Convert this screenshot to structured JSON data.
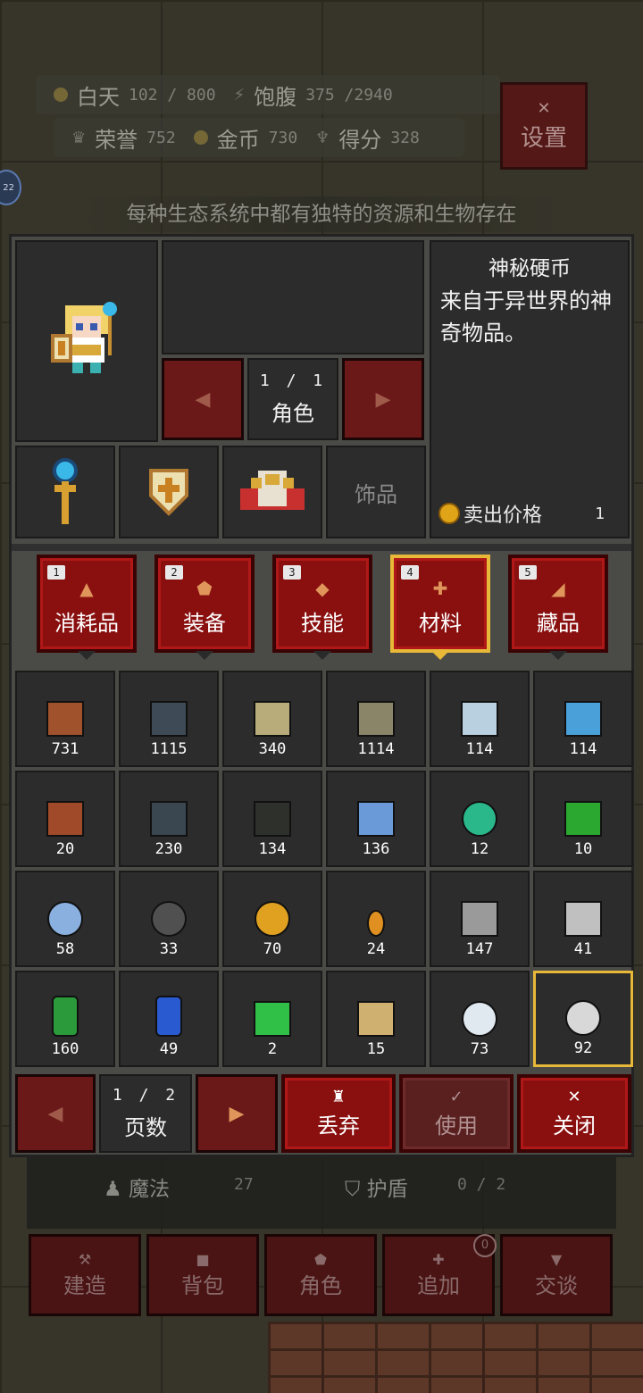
{
  "hud": {
    "day_label": "白天",
    "day_value": "102 / 800",
    "satiety_label": "饱腹",
    "satiety_value": "375 /2940",
    "honor_label": "荣誉",
    "honor_value": "752",
    "gold_label": "金币",
    "gold_value": "730",
    "score_label": "得分",
    "score_value": "328",
    "settings_label": "设置"
  },
  "tip": "每种生态系统中都有独特的资源和生物存在",
  "character": {
    "page": "1 / 1",
    "page_label": "角色",
    "accessory_label": "饰品"
  },
  "description": {
    "title": "神秘硬币",
    "text": "来自于异世界的神奇物品。",
    "sell_label": "卖出价格",
    "sell_value": "1"
  },
  "tabs": [
    {
      "num": "1",
      "label": "消耗品"
    },
    {
      "num": "2",
      "label": "装备"
    },
    {
      "num": "3",
      "label": "技能"
    },
    {
      "num": "4",
      "label": "材料",
      "active": true
    },
    {
      "num": "5",
      "label": "藏品"
    }
  ],
  "items": [
    {
      "count": "731",
      "icon": "dirt-block",
      "color": "#a0522d"
    },
    {
      "count": "1115",
      "icon": "stone-block",
      "color": "#3e4a55"
    },
    {
      "count": "340",
      "icon": "sand-block",
      "color": "#b8ad7a"
    },
    {
      "count": "1114",
      "icon": "sandstone-block",
      "color": "#8a8468"
    },
    {
      "count": "114",
      "icon": "ice-block",
      "color": "#b8d0e0"
    },
    {
      "count": "114",
      "icon": "crystal-block",
      "color": "#4aa0d8"
    },
    {
      "count": "20",
      "icon": "brick-block",
      "color": "#a04a2a"
    },
    {
      "count": "230",
      "icon": "stone-brick",
      "color": "#3a4650"
    },
    {
      "count": "134",
      "icon": "dark-brick",
      "color": "#2e302c"
    },
    {
      "count": "136",
      "icon": "glass-block",
      "color": "#6a9ad8"
    },
    {
      "count": "12",
      "icon": "potion",
      "color": "#2ab88a"
    },
    {
      "count": "10",
      "icon": "slime-cube",
      "color": "#2aa830"
    },
    {
      "count": "58",
      "icon": "gear-orb",
      "color": "#8ab0e0"
    },
    {
      "count": "33",
      "icon": "coal-ore",
      "color": "#505050"
    },
    {
      "count": "70",
      "icon": "gold-ore",
      "color": "#e0a020"
    },
    {
      "count": "24",
      "icon": "amber-shard",
      "color": "#e09020"
    },
    {
      "count": "147",
      "icon": "iron-plate",
      "color": "#9a9a9a"
    },
    {
      "count": "41",
      "icon": "metal-part",
      "color": "#c0c0c0"
    },
    {
      "count": "160",
      "icon": "emerald",
      "color": "#2a9a3a"
    },
    {
      "count": "49",
      "icon": "sapphire",
      "color": "#2a5ad0"
    },
    {
      "count": "2",
      "icon": "green-crystals",
      "color": "#30c048"
    },
    {
      "count": "15",
      "icon": "topaz-crystals",
      "color": "#d0b070"
    },
    {
      "count": "73",
      "icon": "mushroom",
      "color": "#e0e8f0"
    },
    {
      "count": "92",
      "icon": "mystery-coin",
      "color": "#d8d8d8",
      "selected": true
    }
  ],
  "pager": {
    "page": "1 / 2",
    "label": "页数"
  },
  "actions": {
    "discard": "丢弃",
    "use": "使用",
    "close": "关闭"
  },
  "stats": {
    "magic_label": "魔法",
    "magic_value": "27",
    "shield_label": "护盾",
    "shield_value": "0 / 2"
  },
  "nav": {
    "build": "建造",
    "bag": "背包",
    "character": "角色",
    "add": "追加",
    "add_badge": "0",
    "talk": "交谈"
  }
}
